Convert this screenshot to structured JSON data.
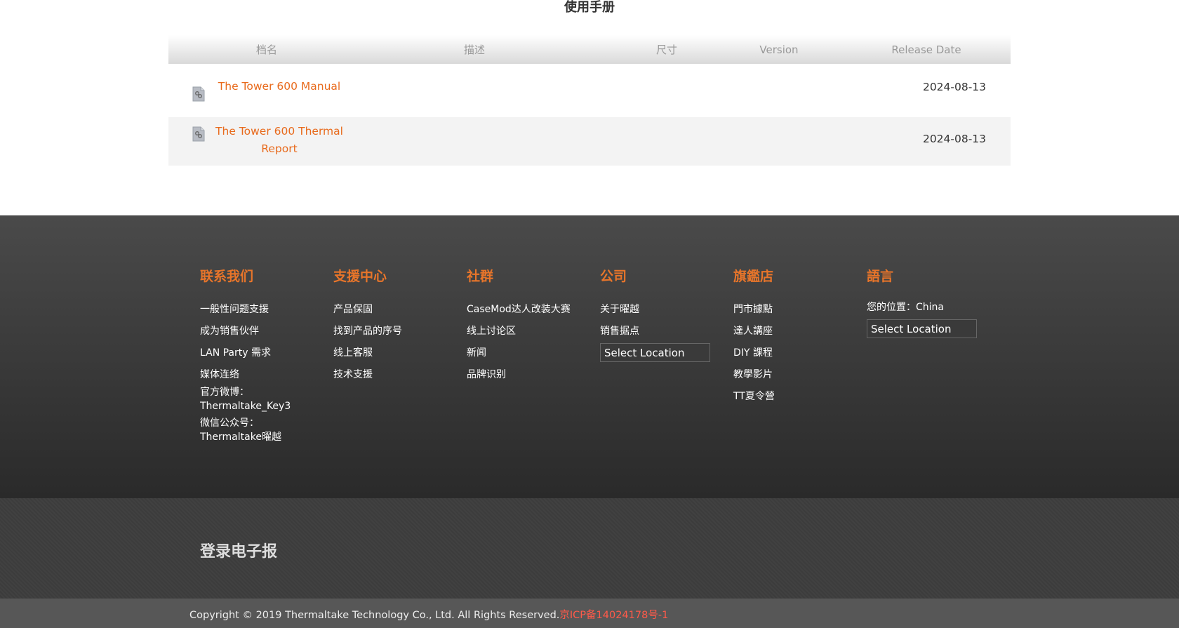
{
  "section": {
    "title": "使用手册"
  },
  "table": {
    "headers": [
      "档名",
      "描述",
      "尺寸",
      "Version",
      "Release Date"
    ],
    "rows": [
      {
        "name": "The Tower 600 Manual",
        "date": "2024-08-13"
      },
      {
        "name_line1": "The Tower 600 Thermal",
        "name_line2": "Report",
        "date": "2024-08-13"
      }
    ]
  },
  "footer": {
    "contact": {
      "title": "联系我们",
      "links": [
        "一般性问题支援",
        "成为销售伙伴",
        "LAN Party 需求",
        "媒体连络"
      ],
      "weibo_label": "官方微博：",
      "weibo_value": "Thermaltake_Key3",
      "wechat_label": "微信公众号：",
      "wechat_value": "Thermaltake曜越"
    },
    "support": {
      "title": "支援中心",
      "links": [
        "产品保固",
        "找到产品的序号",
        "线上客服",
        "技术支援"
      ]
    },
    "community": {
      "title": "社群",
      "links": [
        "CaseMod达人改装大赛",
        "线上讨论区",
        "新闻",
        "品牌识别"
      ]
    },
    "company": {
      "title": "公司",
      "links": [
        "关于曜越",
        "销售据点"
      ],
      "select": "Select Location"
    },
    "store": {
      "title": "旗鑑店",
      "links": [
        "門市據點",
        "達人講座",
        "DIY 課程",
        "教學影片",
        "TT夏令營"
      ]
    },
    "language": {
      "title": "語言",
      "location_label": "您的位置：China",
      "select": "Select Location"
    }
  },
  "newsletter": {
    "title": "登录电子报"
  },
  "copyright": {
    "text": "Copyright © 2019 Thermaltake Technology Co., Ltd. All Rights Reserved.",
    "icp": "京ICP备14024178号-1"
  },
  "colors": {
    "accent": "#e86a1c",
    "icp": "#ff5a4a"
  }
}
